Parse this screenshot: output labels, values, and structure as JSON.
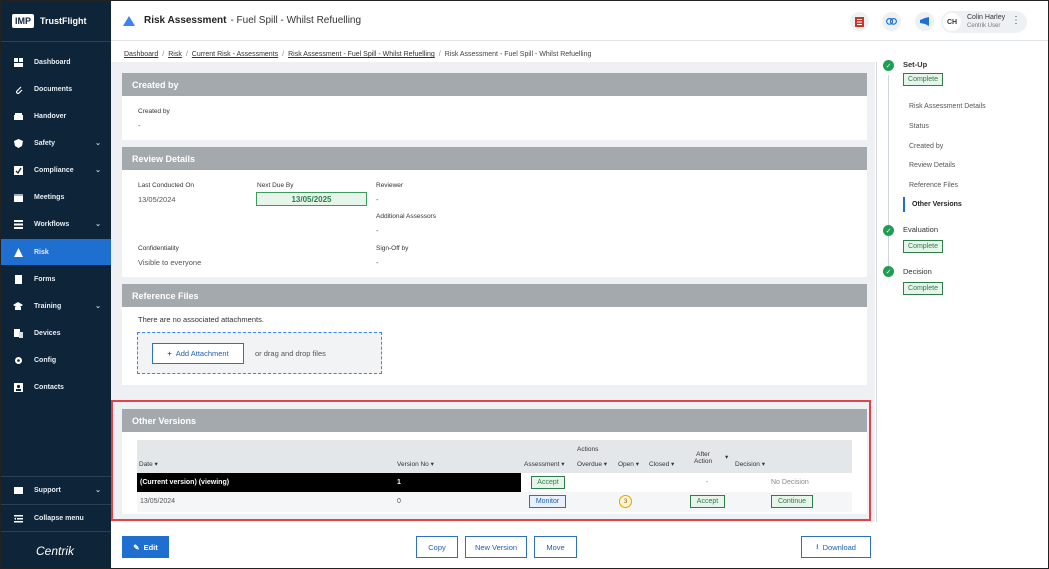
{
  "brand": {
    "logo": "IMP",
    "name": "TrustFlight",
    "footer": "Centrik"
  },
  "sidebar": {
    "items": [
      {
        "label": "Dashboard",
        "icon": "dashboard-icon",
        "chevron": false,
        "active": false
      },
      {
        "label": "Documents",
        "icon": "paperclip-icon",
        "chevron": false,
        "active": false
      },
      {
        "label": "Handover",
        "icon": "handover-icon",
        "chevron": false,
        "active": false
      },
      {
        "label": "Safety",
        "icon": "shield-icon",
        "chevron": true,
        "active": false
      },
      {
        "label": "Compliance",
        "icon": "compliance-icon",
        "chevron": true,
        "active": false
      },
      {
        "label": "Meetings",
        "icon": "calendar-icon",
        "chevron": false,
        "active": false
      },
      {
        "label": "Workflows",
        "icon": "workflow-icon",
        "chevron": true,
        "active": false
      },
      {
        "label": "Risk",
        "icon": "warning-icon",
        "chevron": false,
        "active": true
      },
      {
        "label": "Forms",
        "icon": "forms-icon",
        "chevron": false,
        "active": false
      },
      {
        "label": "Training",
        "icon": "graduation-cap-icon",
        "chevron": true,
        "active": false
      },
      {
        "label": "Devices",
        "icon": "devices-icon",
        "chevron": false,
        "active": false
      },
      {
        "label": "Config",
        "icon": "config-icon",
        "chevron": false,
        "active": false
      },
      {
        "label": "Contacts",
        "icon": "contacts-icon",
        "chevron": false,
        "active": false
      }
    ],
    "support": "Support",
    "collapse": "Collapse menu"
  },
  "header": {
    "title": "Risk Assessment",
    "subtitle": "- Fuel Spill - Whilst Refuelling",
    "user_initials": "CH",
    "user_name": "Colin Harley",
    "user_role": "Centrik User"
  },
  "breadcrumb": [
    "Dashboard",
    "Risk",
    "Current Risk - Assessments",
    "Risk Assessment - Fuel Spill - Whilst Refuelling",
    "Risk Assessment - Fuel Spill - Whilst Refuelling"
  ],
  "created_by": {
    "section_title": "Created by",
    "label": "Created by",
    "value": "-"
  },
  "review": {
    "section_title": "Review Details",
    "last_conducted_label": "Last Conducted On",
    "last_conducted": "13/05/2024",
    "next_due_label": "Next Due By",
    "next_due": "13/05/2025",
    "reviewer_label": "Reviewer",
    "reviewer": "-",
    "additional_label": "Additional Assessors",
    "additional": "-",
    "confidentiality_label": "Confidentiality",
    "confidentiality": "Visible to everyone",
    "signoff_label": "Sign-Off by",
    "signoff": "-"
  },
  "files": {
    "section_title": "Reference Files",
    "empty": "There are no associated attachments.",
    "add_button": "Add Attachment",
    "drop_text": "or drag and drop files"
  },
  "versions": {
    "section_title": "Other Versions",
    "actions_header": "Actions",
    "columns": {
      "date": "Date",
      "version": "Version No",
      "assessment": "Assessment",
      "overdue": "Overdue",
      "open": "Open",
      "closed": "Closed",
      "after_action_1": "After",
      "after_action_2": "Action",
      "decision": "Decision"
    },
    "rows": [
      {
        "date": "(Current version) (viewing)",
        "version": "1",
        "assessment": "Accept",
        "open": "",
        "after_action": "-",
        "decision": "No Decision"
      },
      {
        "date": "13/05/2024",
        "version": "0",
        "assessment": "Monitor",
        "open": "3",
        "after_action": "Accept",
        "decision": "Continue"
      }
    ]
  },
  "buttons": {
    "edit": "Edit",
    "copy": "Copy",
    "new_version": "New Version",
    "move": "Move",
    "download": "Download"
  },
  "progress": {
    "setup": "Set-Up",
    "setup_status": "Complete",
    "sub_items": [
      "Risk Assessment Details",
      "Status",
      "Created by",
      "Review Details",
      "Reference Files",
      "Other Versions"
    ],
    "active_sub": "Other Versions",
    "evaluation": "Evaluation",
    "evaluation_status": "Complete",
    "decision": "Decision",
    "decision_status": "Complete"
  },
  "colors": {
    "sidebar": "#0e2438",
    "accent": "#1f6fd0",
    "success": "#1f9d55",
    "highlight": "#e0444b"
  }
}
